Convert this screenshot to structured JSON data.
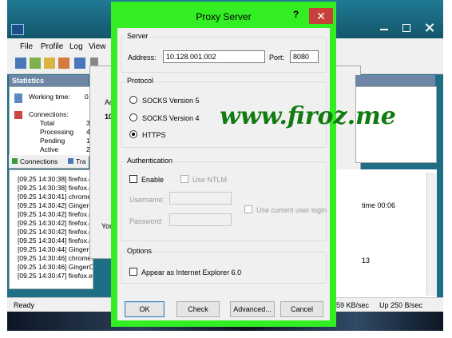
{
  "background_app": {
    "menu": [
      "File",
      "Profile",
      "Log",
      "View"
    ],
    "statistics_title": "Statistics",
    "stats": {
      "working_time_label": "Working time:",
      "working_time_value": "0",
      "connections_label": "Connections:",
      "rows": [
        {
          "label": "Total",
          "value": "3"
        },
        {
          "label": "Processing",
          "value": "4"
        },
        {
          "label": "Pending",
          "value": "1"
        },
        {
          "label": "Active",
          "value": "2"
        }
      ]
    },
    "tabs": [
      "Connections",
      "Tra"
    ],
    "log_lines": [
      "[09.25 14:30:38] firefox.exe",
      "[09.25 14:30:38] firefox.exe",
      "[09.25 14:30:41] chrome.exe",
      "[09.25 14:30:42] GingerCl",
      "[09.25 14:30:42] firefox.exe",
      "[09.25 14:30:42] firefox.exe",
      "[09.25 14:30:42] firefox.exe",
      "[09.25 14:30:44] firefox.exe",
      "[09.25 14:30:44] GingerCl",
      "[09.25 14:30:46] chrome.exe",
      "[09.25 14:30:46] GingerCl",
      "[09.25 14:30:47] firefox.exe - nwi.a"
    ],
    "mid_fragments": {
      "a": "Ad",
      "b": "10",
      "you": "You"
    },
    "right_text": {
      "time": "time 00:06",
      "num": "13"
    },
    "status": {
      "ready": "Ready",
      "down": "59 KB/sec",
      "up": "Up 250 B/sec"
    }
  },
  "dialog": {
    "title": "Proxy Server",
    "help": "?",
    "close": "✕",
    "server": {
      "group_label": "Server",
      "address_label": "Address:",
      "address_value": "10.128.001.002",
      "port_label": "Port:",
      "port_value": "8080"
    },
    "protocol": {
      "group_label": "Protocol",
      "options": [
        "SOCKS Version 5",
        "SOCKS Version 4",
        "HTTPS"
      ],
      "selected": "HTTPS"
    },
    "authentication": {
      "group_label": "Authentication",
      "enable_label": "Enable",
      "use_ntlm_label": "Use NTLM",
      "username_label": "Username:",
      "password_label": "Password:",
      "use_current_user_label": "Use current user login"
    },
    "options": {
      "group_label": "Options",
      "appear_ie_label": "Appear as Internet Explorer 6.0"
    },
    "buttons": {
      "ok": "OK",
      "check": "Check",
      "advanced": "Advanced...",
      "cancel": "Cancel"
    }
  },
  "watermark": "www.firoz.me",
  "colors": {
    "dialog_frame": "#33ee22",
    "close_button": "#c7413a",
    "watermark": "#117a11"
  }
}
